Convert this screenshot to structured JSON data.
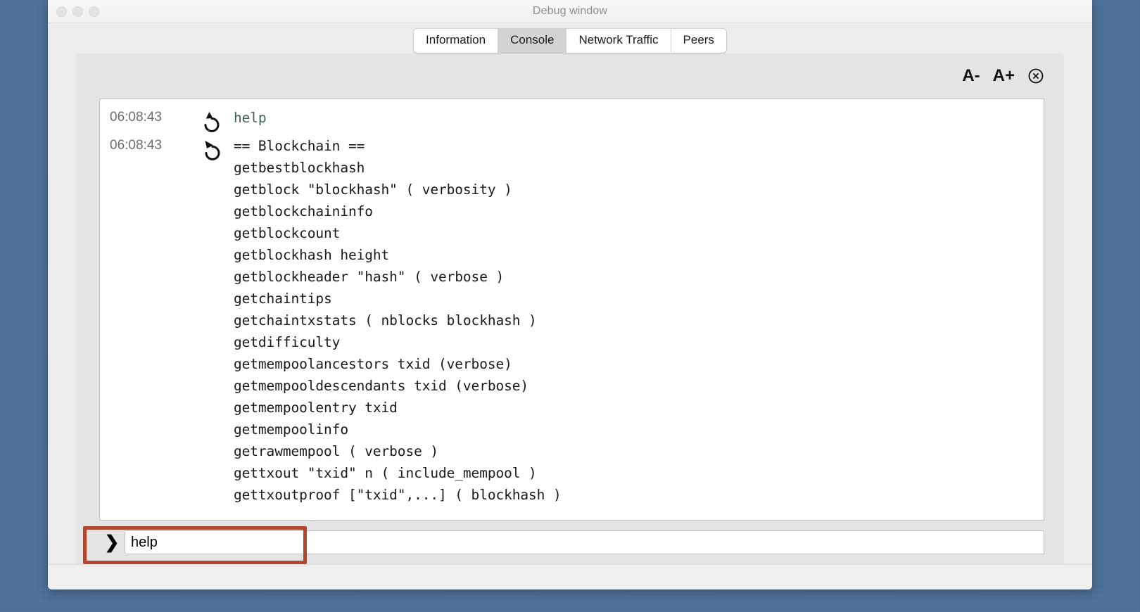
{
  "window": {
    "title": "Debug window",
    "traffic_lights": [
      "close",
      "minimize",
      "zoom"
    ]
  },
  "tabs": [
    {
      "label": "Information",
      "active": false
    },
    {
      "label": "Console",
      "active": true
    },
    {
      "label": "Network Traffic",
      "active": false
    },
    {
      "label": "Peers",
      "active": false
    }
  ],
  "toolbar": {
    "font_smaller_label": "A-",
    "font_bigger_label": "A+",
    "clear_label": "⊗"
  },
  "console": {
    "entries": [
      {
        "time": "06:08:43",
        "direction": "out",
        "type": "command",
        "text": "help"
      },
      {
        "time": "06:08:43",
        "direction": "in",
        "type": "response",
        "text": "== Blockchain ==\ngetbestblockhash\ngetblock \"blockhash\" ( verbosity )\ngetblockchaininfo\ngetblockcount\ngetblockhash height\ngetblockheader \"hash\" ( verbose )\ngetchaintips\ngetchaintxstats ( nblocks blockhash )\ngetdifficulty\ngetmempoolancestors txid (verbose)\ngetmempooldescendants txid (verbose)\ngetmempoolentry txid\ngetmempoolinfo\ngetrawmempool ( verbose )\ngettxout \"txid\" n ( include_mempool )\ngettxoutproof [\"txid\",...] ( blockhash )"
      }
    ]
  },
  "input": {
    "prompt": "❯",
    "value": "help",
    "placeholder": ""
  },
  "colors": {
    "desktop": "#4a7099",
    "window_bg": "#ececec",
    "panel_bg": "#e4e4e4",
    "command_text": "#3f5f5f",
    "timestamp_text": "#6e6e6e",
    "annotation": "#b2462f",
    "active_tab_bg": "#d3d3d3"
  }
}
